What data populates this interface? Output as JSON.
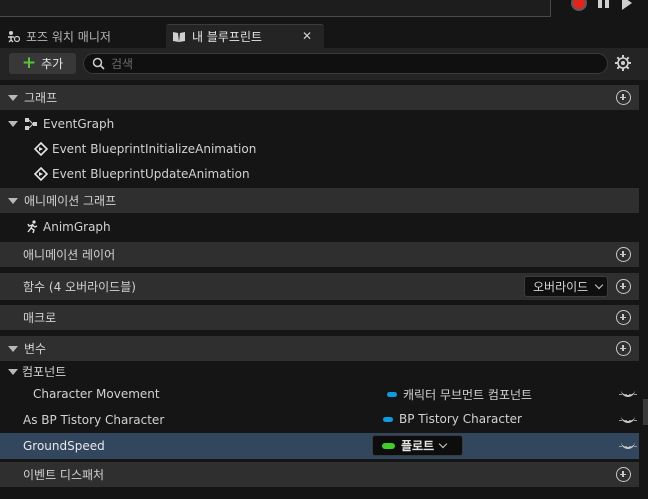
{
  "tabs": [
    {
      "label": "포즈 워치 매니저",
      "icon": "pose-watch-icon"
    },
    {
      "label": "내 블루프린트",
      "icon": "book-icon",
      "active": true
    }
  ],
  "toolbar": {
    "add_label": "추가",
    "search_placeholder": "검색"
  },
  "sections": {
    "graphs": {
      "title": "그래프"
    },
    "event_graph": {
      "label": "EventGraph"
    },
    "events": [
      {
        "label": "Event BlueprintInitializeAnimation"
      },
      {
        "label": "Event BlueprintUpdateAnimation"
      }
    ],
    "anim_graphs": {
      "title": "애니메이션 그래프"
    },
    "anim_graph": {
      "label": "AnimGraph"
    },
    "anim_layers": {
      "title": "애니메이션 레이어"
    },
    "functions": {
      "title": "함수 (4 오버라이드블)",
      "override_label": "오버라이드"
    },
    "macros": {
      "title": "매크로"
    },
    "variables": {
      "title": "변수"
    },
    "components": {
      "title": "컴포넌트"
    },
    "variable_rows": [
      {
        "name": "Character Movement",
        "type": "캐릭터 무브먼트 컴포넌트",
        "color": "#0f9be0"
      },
      {
        "name": "As BP Tistory Character",
        "type": "BP Tistory Character",
        "color": "#0f9be0"
      },
      {
        "name": "GroundSpeed",
        "type": "플로트",
        "color": "#3fcf2a",
        "selected": true
      }
    ],
    "dispatchers": {
      "title": "이벤트 디스패처"
    }
  }
}
